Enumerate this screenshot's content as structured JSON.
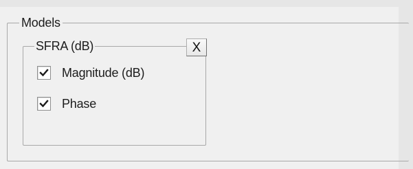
{
  "models_group": {
    "title": "Models",
    "sfra_group": {
      "title": "SFRA (dB)",
      "close_label": "X",
      "options": [
        {
          "label": "Magnitude (dB)",
          "checked": true
        },
        {
          "label": "Phase",
          "checked": true
        }
      ]
    }
  },
  "colors": {
    "background": "#e6e6e6",
    "panel": "#f0f0f0",
    "border": "#a8a8a8"
  },
  "icons": [
    "checkmark-icon"
  ]
}
